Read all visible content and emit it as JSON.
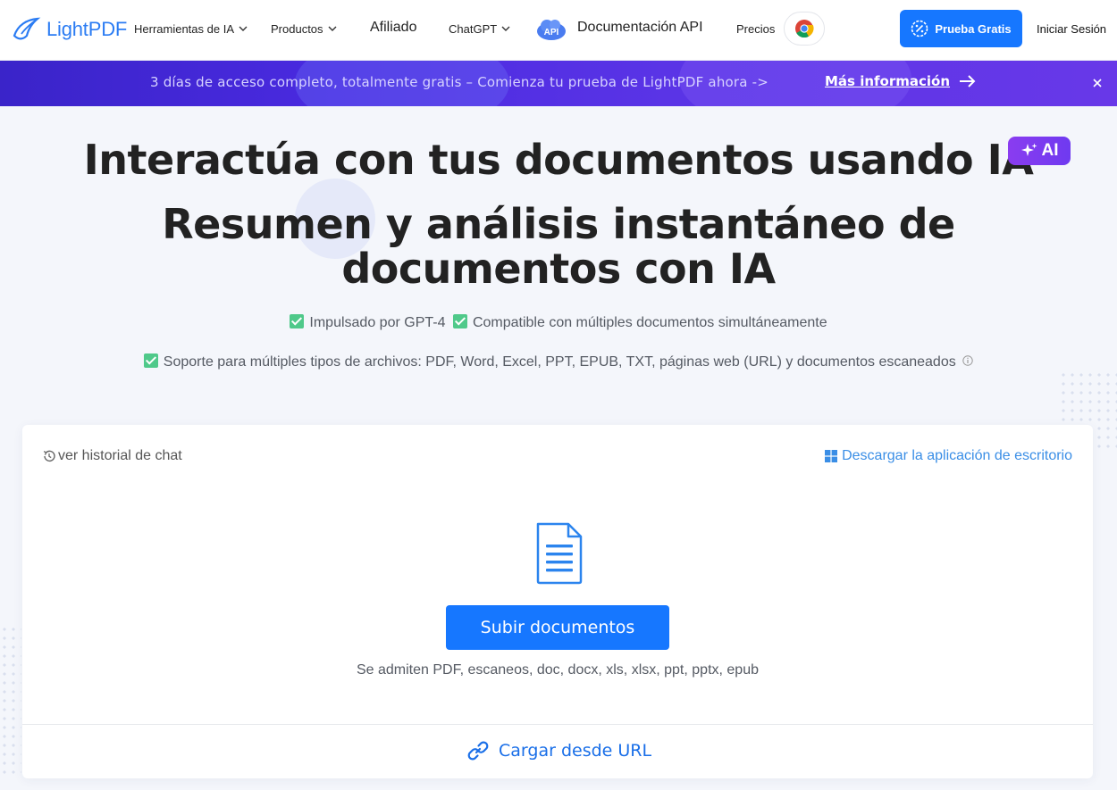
{
  "nav": {
    "logo_text_light": "Light",
    "logo_text_pdf": "PDF",
    "items": [
      {
        "label": "Herramientas de IA",
        "has_dropdown": true
      },
      {
        "label": "Productos",
        "has_dropdown": true
      },
      {
        "label": "Afiliado",
        "has_dropdown": false
      },
      {
        "label": "ChatGPT",
        "has_dropdown": true
      },
      {
        "label": "Documentación API",
        "has_dropdown": false
      },
      {
        "label": "Precios",
        "has_dropdown": false
      }
    ],
    "api_badge": "API",
    "try_button": "Prueba Gratis",
    "login": "Iniciar Sesión"
  },
  "promo": {
    "text": "3 días de acceso completo, totalmente gratis – Comienza tu prueba de LightPDF ahora ->",
    "link": "Más información"
  },
  "hero": {
    "title": "Interactúa con tus documentos usando IA",
    "ai_tag": "AI",
    "subtitle": "Resumen y análisis instantáneo de documentos con IA",
    "feature_1a": "Impulsado por GPT-4",
    "feature_1b": "Compatible con múltiples documentos simultáneamente",
    "feature_2": "Soporte para múltiples tipos de archivos: PDF, Word, Excel, PPT, EPUB, TXT, páginas web (URL) y documentos escaneados"
  },
  "card": {
    "history": "ver historial de chat",
    "desktop": "Descargar la aplicación de escritorio",
    "upload_button": "Subir documentos",
    "formats": "Se admiten PDF, escaneos, doc, docx, xls, xlsx, ppt, pptx, epub",
    "url_load": "Cargar desde URL"
  },
  "colors": {
    "brand_blue": "#1677ff",
    "promo_purple": "#4a2ae0",
    "ai_purple": "#8a3cf0",
    "check_green": "#4fc98a"
  },
  "icons": [
    "logo-icon",
    "chevron-down-icon",
    "api-badge-icon",
    "chrome-icon",
    "sparkle-icon",
    "arrow-right-icon",
    "close-icon",
    "check-icon",
    "info-icon",
    "history-icon",
    "windows-icon",
    "document-icon",
    "link-icon"
  ]
}
